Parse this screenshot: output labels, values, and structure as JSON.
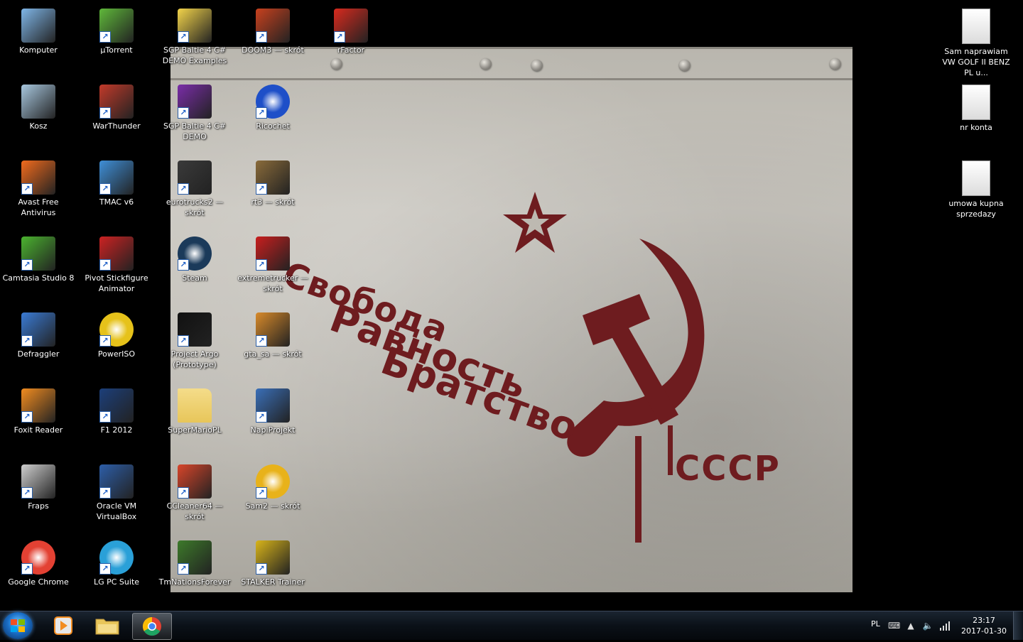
{
  "desktop": {
    "icons": [
      {
        "label": "Komputer",
        "icon": "computer-icon",
        "shortcut": false,
        "color": "#7fb6e8"
      },
      {
        "label": "Kosz",
        "icon": "recycle-bin-icon",
        "shortcut": false,
        "color": "#a8c8e0"
      },
      {
        "label": "Avast Free Antivirus",
        "icon": "avast-icon",
        "shortcut": true,
        "color": "#f26b1d"
      },
      {
        "label": "Camtasia Studio 8",
        "icon": "camtasia-icon",
        "shortcut": true,
        "color": "#4bb32f"
      },
      {
        "label": "Defraggler",
        "icon": "defraggler-icon",
        "shortcut": true,
        "color": "#3a7bd5"
      },
      {
        "label": "Foxit Reader",
        "icon": "foxit-icon",
        "shortcut": true,
        "color": "#f28c20"
      },
      {
        "label": "Fraps",
        "icon": "fraps-icon",
        "shortcut": true,
        "color": "#cfcfcf"
      },
      {
        "label": "Google Chrome",
        "icon": "chrome-icon",
        "shortcut": true,
        "color": "#e34133"
      },
      {
        "label": "µTorrent",
        "icon": "utorrent-icon",
        "shortcut": true,
        "color": "#5fb83a"
      },
      {
        "label": "WarThunder",
        "icon": "warthunder-icon",
        "shortcut": true,
        "color": "#c23a2a"
      },
      {
        "label": "TMAC v6",
        "icon": "tmac-icon",
        "shortcut": true,
        "color": "#3f8fd8"
      },
      {
        "label": "Pivot Stickfigure Animator",
        "icon": "pivot-icon",
        "shortcut": true,
        "color": "#cc2222"
      },
      {
        "label": "PowerISO",
        "icon": "poweriso-icon",
        "shortcut": true,
        "color": "#e6c21a"
      },
      {
        "label": "F1 2012",
        "icon": "f1-icon",
        "shortcut": true,
        "color": "#1c3f7a"
      },
      {
        "label": "Oracle VM VirtualBox",
        "icon": "virtualbox-icon",
        "shortcut": true,
        "color": "#2d5ea8"
      },
      {
        "label": "LG PC Suite",
        "icon": "lg-pc-suite-icon",
        "shortcut": true,
        "color": "#2aa0d8"
      },
      {
        "label": "SGP Baltie 4 C# DEMO Examples",
        "icon": "baltie-examples-icon",
        "shortcut": true,
        "color": "#f3d44a"
      },
      {
        "label": "SGP Baltie 4 C# DEMO",
        "icon": "baltie-icon",
        "shortcut": true,
        "color": "#7a2da8"
      },
      {
        "label": "eurotrucks2 — skrót",
        "icon": "eurotrucks-icon",
        "shortcut": true,
        "color": "#3a3a3a"
      },
      {
        "label": "Steam",
        "icon": "steam-icon",
        "shortcut": true,
        "color": "#1b3a5a"
      },
      {
        "label": "Project Argo (Prototype)",
        "icon": "argo-icon",
        "shortcut": true,
        "color": "#111111"
      },
      {
        "label": "SuperMarioPL",
        "icon": "folder-icon",
        "shortcut": false,
        "color": "#e8c65a"
      },
      {
        "label": "CCleaner64 — skrót",
        "icon": "ccleaner-icon",
        "shortcut": true,
        "color": "#d8452a"
      },
      {
        "label": "TmNationsForever",
        "icon": "tmnations-icon",
        "shortcut": true,
        "color": "#3d7a2a"
      },
      {
        "label": "DOOM3 — skrót",
        "icon": "doom3-icon",
        "shortcut": true,
        "color": "#c8411e"
      },
      {
        "label": "Ricochet",
        "icon": "ricochet-icon",
        "shortcut": true,
        "color": "#1e4fc8"
      },
      {
        "label": "rt3 — skrót",
        "icon": "rt3-icon",
        "shortcut": true,
        "color": "#8a6b3a"
      },
      {
        "label": "extremetrucker — skrót",
        "icon": "extremetrucker-icon",
        "shortcut": true,
        "color": "#c81e1e"
      },
      {
        "label": "gta_sa — skrót",
        "icon": "gta-sa-icon",
        "shortcut": true,
        "color": "#d88a2a"
      },
      {
        "label": "NapiProjekt",
        "icon": "napiprojekt-icon",
        "shortcut": true,
        "color": "#3a6fb8"
      },
      {
        "label": "Sam2 — skrót",
        "icon": "sam2-icon",
        "shortcut": true,
        "color": "#e8b21a"
      },
      {
        "label": "STALKER Trainer",
        "icon": "stalker-icon",
        "shortcut": true,
        "color": "#d8b41a"
      },
      {
        "label": "rFactor",
        "icon": "rfactor-icon",
        "shortcut": true,
        "color": "#d82a1e"
      },
      {
        "label": "Sam naprawiam VW GOLF II BENZ PL u...",
        "icon": "document-icon",
        "shortcut": false,
        "color": "#f0f0f0"
      },
      {
        "label": "nr konta",
        "icon": "text-file-icon",
        "shortcut": false,
        "color": "#f0f0f0"
      },
      {
        "label": "umowa kupna sprzedazy",
        "icon": "document-icon",
        "shortcut": false,
        "color": "#f0f0f0"
      }
    ]
  },
  "wallpaper": {
    "slogans": [
      "Свобода",
      "Равность",
      "Братство"
    ],
    "emblem_text": "СССР",
    "color": "#6e1c1f"
  },
  "taskbar": {
    "start_icon": "windows-start-icon",
    "pinned": [
      {
        "icon": "media-player-icon",
        "active": false
      },
      {
        "icon": "explorer-folder-icon",
        "active": false
      },
      {
        "icon": "chrome-icon",
        "active": true
      }
    ],
    "tray": {
      "language": "PL",
      "icons": [
        "keyboard-icon",
        "show-hidden-icon",
        "volume-icon",
        "network-icon"
      ],
      "time": "23:17",
      "date": "2017-01-30"
    }
  }
}
